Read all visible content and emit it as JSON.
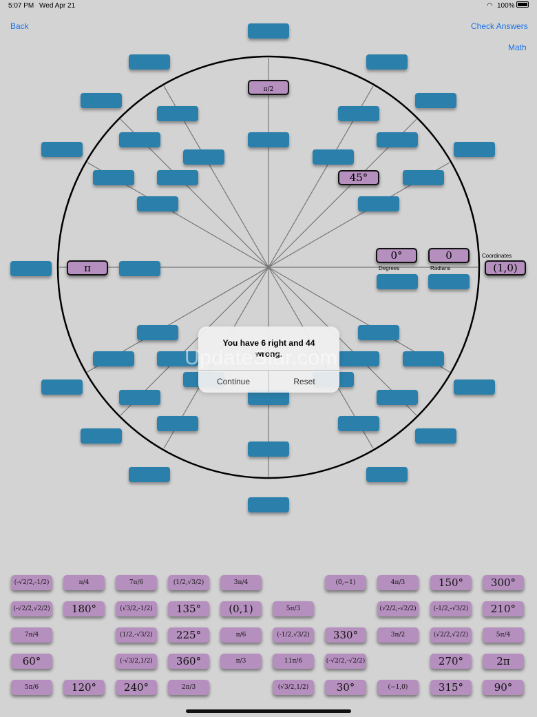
{
  "status_bar": {
    "time": "5:07 PM",
    "date": "Wed Apr 21",
    "battery": "100%"
  },
  "nav": {
    "back": "Back",
    "check_answers": "Check Answers",
    "math": "Math"
  },
  "placed": {
    "top": "π/2",
    "deg45": "45°",
    "left": "π",
    "degrees": "0°",
    "radians": "0",
    "coordinates": "(1,0)"
  },
  "labels": {
    "degrees": "Degrees",
    "radians": "Radians",
    "coordinates": "Coordinates"
  },
  "dialog": {
    "message": "You have 6 right and 44 wrong.",
    "continue": "Continue",
    "reset": "Reset"
  },
  "watermark": "UpdateStar.com",
  "tiles": {
    "r0": [
      "(-√2/2,-1/2)",
      "π/4",
      "7π/6",
      "(1/2,√3/2)",
      "3π/4",
      "",
      "(0,−1)",
      "4π/3",
      "150°",
      "300°"
    ],
    "r1": [
      "(-√2/2,√2/2)",
      "180°",
      "(√3/2,-1/2)",
      "135°",
      "(0,1)",
      "5π/3",
      "",
      "(√2/2,-√2/2)",
      "(-1/2,-√3/2)",
      "210°"
    ],
    "r2": [
      "7π/4",
      "",
      "(1/2,-√3/2)",
      "225°",
      "π/6",
      "(-1/2,√3/2)",
      "330°",
      "3π/2",
      "(√2/2,√2/2)",
      "5π/4"
    ],
    "r3": [
      "60°",
      "",
      "(-√3/2,1/2)",
      "360°",
      "π/3",
      "11π/6",
      "(-√2/2,-√2/2)",
      "",
      "270°",
      "2π"
    ],
    "r4": [
      "5π/6",
      "120°",
      "240°",
      "2π/3",
      "",
      "(√3/2,1/2)",
      "30°",
      "(−1,0)",
      "315°",
      "90°"
    ]
  }
}
